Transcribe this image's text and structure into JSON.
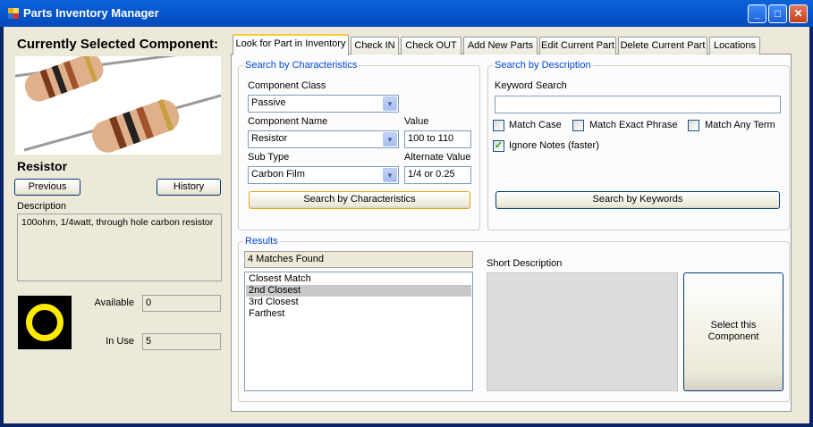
{
  "window": {
    "title": "Parts Inventory Manager"
  },
  "left": {
    "current_label": "Currently Selected Component:",
    "component_name": "Resistor",
    "previous_button": "Previous",
    "history_button": "History",
    "description_label": "Description",
    "description": "100ohm, 1/4watt, through hole carbon resistor",
    "available_label": "Available",
    "available_value": "0",
    "in_use_label": "In Use",
    "in_use_value": "5"
  },
  "tabs": [
    {
      "label": "Look for Part in Inventory",
      "active": true
    },
    {
      "label": "Check IN"
    },
    {
      "label": "Check  OUT"
    },
    {
      "label": "Add New Parts"
    },
    {
      "label": "Edit Current Part"
    },
    {
      "label": "Delete Current Part"
    },
    {
      "label": "Locations"
    }
  ],
  "characteristics": {
    "group_title": "Search by Characteristics",
    "component_class_label": "Component Class",
    "component_class_value": "Passive",
    "component_name_label": "Component Name",
    "component_name_value": "Resistor",
    "value_label": "Value",
    "value_value": "100 to 110",
    "sub_type_label": "Sub Type",
    "sub_type_value": "Carbon Film",
    "alternate_label": "Alternate Value",
    "alternate_value": "1/4 or 0.25",
    "search_button": "Search by Characteristics"
  },
  "description_search": {
    "group_title": "Search by Description",
    "keyword_label": "Keyword Search",
    "keyword_value": "",
    "match_case": {
      "label": "Match Case",
      "checked": false
    },
    "match_exact": {
      "label": "Match Exact Phrase",
      "checked": false
    },
    "match_any": {
      "label": "Match Any Term",
      "checked": false
    },
    "ignore_notes": {
      "label": "Ignore Notes (faster)",
      "checked": true
    },
    "search_button": "Search by Keywords"
  },
  "results": {
    "group_title": "Results",
    "count_text": "4 Matches Found",
    "items": [
      "Closest Match",
      "2nd Closest",
      "3rd Closest",
      "Farthest"
    ],
    "selected_index": 1,
    "short_description_label": "Short Description",
    "short_description": "",
    "select_button_line1": "Select this",
    "select_button_line2": "Component"
  },
  "colors": {
    "titlebar": "#0658d1",
    "group_title": "#0046d5",
    "indicator_ring": "#ffea00",
    "indicator_bg": "#000000"
  }
}
